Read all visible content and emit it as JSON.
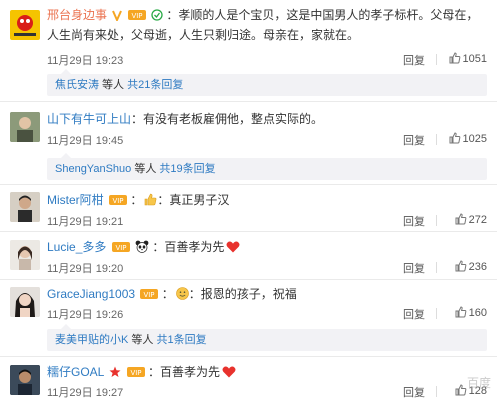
{
  "comments": [
    {
      "user": "邢台身边事",
      "text": "：孝顺的人是个宝贝，这是中国男人的孝子标杆。父母在，人生尚有来处，父母逝，人生只剩归途。母亲在，家就在。",
      "time": "11月29日 19:23",
      "reply": "回复",
      "likes": "1051",
      "sub": {
        "name": "焦氏安涛",
        "text": " 等人 ",
        "more": "共21条回复"
      }
    },
    {
      "user": "山下有牛可上山",
      "text": "：有没有老板雇佣他，整点实际的。",
      "time": "11月29日 19:45",
      "reply": "回复",
      "likes": "1025",
      "sub": {
        "name": "ShengYanShuo",
        "text": " 等人 ",
        "more": "共19条回复"
      }
    },
    {
      "user": "Mister阿柑",
      "text": "：真正男子汉",
      "time": "11月29日 19:21",
      "reply": "回复",
      "likes": "272"
    },
    {
      "user": "Lucie_多多",
      "text": "：百善孝为先",
      "time": "11月29日 19:20",
      "reply": "回复",
      "likes": "236"
    },
    {
      "user": "GraceJiang1003",
      "text": "：报恩的孩子，祝福",
      "time": "11月29日 19:26",
      "reply": "回复",
      "likes": "160",
      "sub": {
        "name": "麦美甲贴的小K",
        "text": " 等人 ",
        "more": "共1条回复"
      }
    },
    {
      "user": "糯仔GOAL",
      "text": "：百善孝为先",
      "time": "11月29日 19:27",
      "reply": "回复",
      "likes": "128"
    }
  ],
  "watermark": "百度",
  "colors": {
    "username": "#eb7350",
    "link": "#2f7bc2",
    "subbox_bg": "#f2f2f5"
  }
}
